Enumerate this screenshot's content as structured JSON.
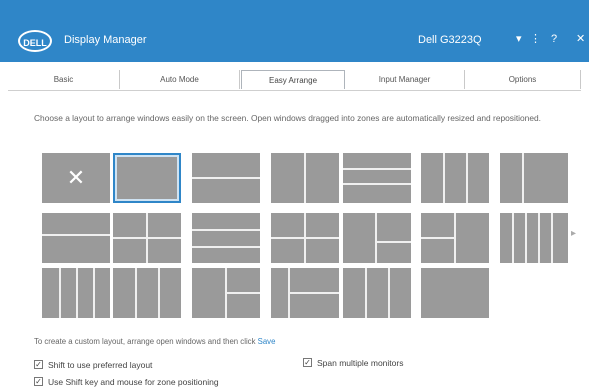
{
  "title_bar": {
    "logo_text": "DELL",
    "app_title": "Display Manager",
    "monitor_name": "Dell G3223Q",
    "controls": [
      "▾",
      "⋮",
      "?",
      "✕"
    ]
  },
  "tabs": [
    {
      "label": "Basic"
    },
    {
      "label": "Auto Mode"
    },
    {
      "label": "Easy Arrange"
    },
    {
      "label": "Input Manager"
    },
    {
      "label": "Options"
    }
  ],
  "active_tab": "Easy Arrange",
  "description": "Choose a layout to arrange windows easily on the screen. Open windows dragged into zones are automatically resized and repositioned.",
  "layouts": [
    {
      "name": "none",
      "selected": false
    },
    {
      "name": "full",
      "selected": true
    },
    {
      "name": "two-rows-top-small"
    },
    {
      "name": "two-columns"
    },
    {
      "name": "three-rows"
    },
    {
      "name": "three-columns"
    },
    {
      "name": "three-columns-alt"
    },
    {
      "name": "two-rows-bottom-big"
    },
    {
      "name": "quad-grid"
    },
    {
      "name": "three-rows-uneven"
    },
    {
      "name": "grid-2x2-small"
    },
    {
      "name": "big-with-small"
    },
    {
      "name": "columns-split"
    },
    {
      "name": "five-columns"
    },
    {
      "name": "four-columns"
    },
    {
      "name": "two-columns-wide"
    },
    {
      "name": "three-columns-right"
    },
    {
      "name": "columns-right-split"
    },
    {
      "name": "grid-three"
    },
    {
      "name": "custom-corner"
    }
  ],
  "more_arrow": "▸",
  "hint": {
    "text": "To create a custom layout, arrange open windows and then click",
    "link": "Save"
  },
  "options": {
    "shift_label": "Shift to use preferred layout",
    "span_label": "Span multiple monitors",
    "snap_label": "Use Shift key and mouse for zone positioning"
  }
}
